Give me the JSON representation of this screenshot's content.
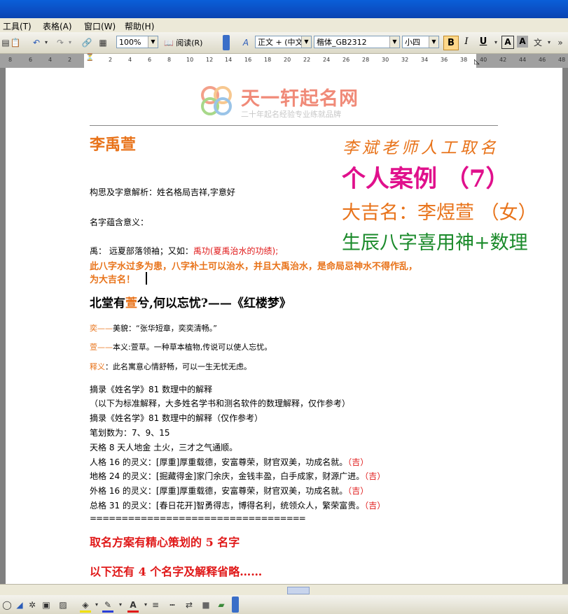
{
  "menu": {
    "tools": "工具(T)",
    "table": "表格(A)",
    "window": "窗口(W)",
    "help": "帮助(H)"
  },
  "toolbar": {
    "zoom": "100%",
    "read_label": "阅读(R)",
    "style": "正文 + (中文",
    "font": "楷体_GB2312",
    "size": "小四",
    "bold": "B",
    "italic": "I",
    "underline": "U",
    "font_color_a": "A"
  },
  "ruler": {
    "ticks": [
      "8",
      "6",
      "4",
      "2",
      "2",
      "4",
      "6",
      "8",
      "10",
      "12",
      "14",
      "16",
      "18",
      "20",
      "22",
      "24",
      "26",
      "28",
      "30",
      "32",
      "34",
      "36",
      "38",
      "40",
      "42",
      "44",
      "46",
      "48"
    ]
  },
  "logo": {
    "brand": "天一轩起名网",
    "slogan": "二十年起名经验专业练就品牌"
  },
  "doc": {
    "name": "李禹萱",
    "overlay_teacher": "李斌老师人工取名",
    "overlay_case": "个人案例 （7）",
    "overlay_name": "大吉名：李煜萱 （女）",
    "overlay_bazi": "生辰八字喜用神+数理",
    "concept": "构思及字意解析：姓名格局吉祥,字意好",
    "meaning_label": "名字蕴含意义：",
    "yu_prefix": "禹：  远夏部落领袖；又如：",
    "yu_red": "禹功(夏禹治水的功绩);",
    "orange1": "此八字水过多为患，八字补土可以治水，并且大禹治水，是命局忌神水不得作乱，",
    "orange2": "为大吉名！",
    "quote_a": "北堂有",
    "quote_xuan": "萱",
    "quote_b": "兮,何以忘忧?——《红楼梦》",
    "yi_label": "奕——",
    "yi_text": "美貌：“张华短章，奕奕清畅。”",
    "xuan_label": "萱——",
    "xuan_text": "本义:萱草。一种草本植物,传说可以使人忘忧。",
    "shiyi_label": "释义",
    "shiyi_text": "：此名寓意心情舒畅，可以一生无忧无虑。",
    "lines": [
      "摘录《姓名学》81 数理中的解释",
      "（以下为标准解释，大多姓名学书和测名软件的数理解释，仅作参考）",
      "摘录《姓名学》81 数理中的解释（仅作参考）",
      "笔划数为：7、9、15",
      "天格 8 天人地金 土火，三才之气通顺。"
    ],
    "ge_lines": [
      {
        "text": "人格 16 的灵义：[厚重]厚重载德，安富尊荣，财官双美，功成名就。",
        "tag": "（吉）"
      },
      {
        "text": "地格 24 的灵义：[掘藏得金]家门余庆，金钱丰盈，白手成家，财源广进。",
        "tag": "（吉）"
      },
      {
        "text": "外格 16 的灵义：[厚重]厚重载德，安富尊荣，财官双美，功成名就。",
        "tag": "（吉）"
      },
      {
        "text": "总格 31 的灵义：[春日花开]智勇得志，博得名利，统领众人，繁荣富贵。",
        "tag": "（吉）"
      }
    ],
    "divider": "==================================",
    "plan": "取名方案有精心策划的 5 名字",
    "more": "以下还有 4 个名字及解释省略……"
  },
  "colors": {
    "orange": "#e8731a",
    "red": "#e01818",
    "magenta": "#e0108c",
    "green": "#1a8a2a",
    "logo_red": "#e8463a"
  }
}
